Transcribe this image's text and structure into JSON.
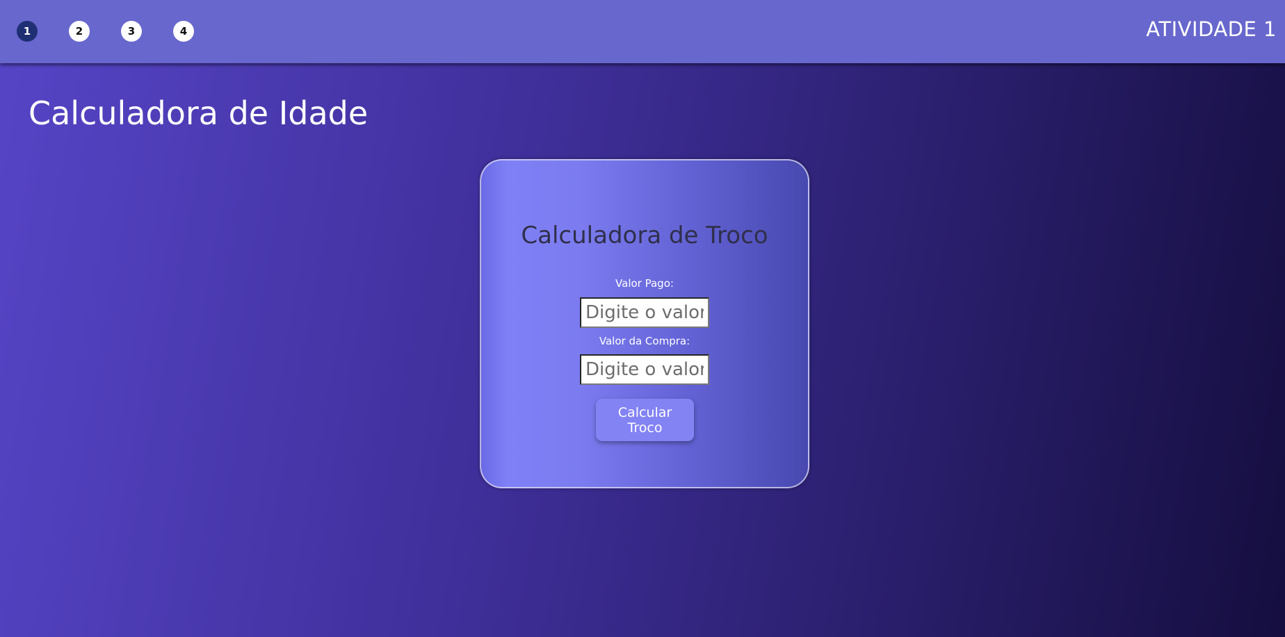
{
  "header": {
    "steps": [
      {
        "label": "1",
        "active": true
      },
      {
        "label": "2",
        "active": false
      },
      {
        "label": "3",
        "active": false
      },
      {
        "label": "4",
        "active": false
      }
    ],
    "activity_title": "ATIVIDADE 1"
  },
  "page": {
    "title": "Calculadora de Idade"
  },
  "card": {
    "title": "Calculadora de Troco",
    "paid_label": "Valor Pago:",
    "paid_placeholder": "Digite o valor",
    "purchase_label": "Valor da Compra:",
    "purchase_placeholder": "Digite o valor",
    "button_label": "Calcular Troco"
  },
  "colors": {
    "topbar": "#6767cd",
    "active_step": "#1f2f74",
    "button": "#8383f4"
  }
}
